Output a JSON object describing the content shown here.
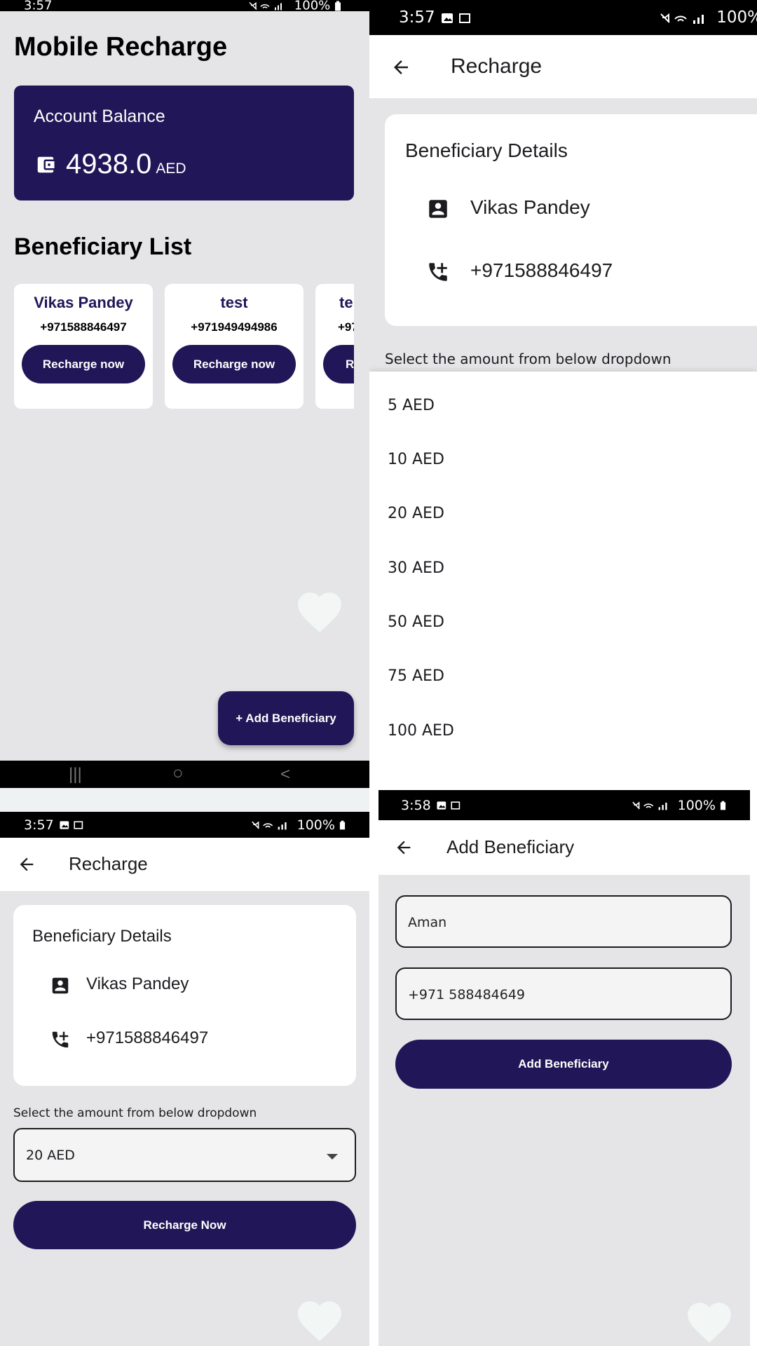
{
  "colors": {
    "primary": "#211657",
    "background": "#e5e5e7",
    "surface": "#ffffff"
  },
  "panel_home": {
    "status": {
      "time": "3:57",
      "battery": "100%"
    },
    "title": "Mobile Recharge",
    "balance": {
      "label": "Account Balance",
      "amount": "4938.0",
      "currency": "AED",
      "icon": "wallet-icon"
    },
    "section_title": "Beneficiary List",
    "beneficiaries": [
      {
        "name": "Vikas Pandey",
        "phone": "+971588846497",
        "button": "Recharge now"
      },
      {
        "name": "test",
        "phone": "+971949494986",
        "button": "Recharge now"
      },
      {
        "name": "te",
        "phone": "+97",
        "button": "R"
      }
    ],
    "fab_label": "+ Add Beneficiary",
    "navbar": {
      "recents": "|||",
      "home": "○",
      "back": "<"
    }
  },
  "panel_recharge_open": {
    "status": {
      "time": "3:57",
      "battery": "100%"
    },
    "title": "Recharge",
    "card_title": "Beneficiary Details",
    "name": "Vikas Pandey",
    "phone": "+971588846497",
    "prompt": "Select the amount from below dropdown",
    "options": [
      "5 AED",
      "10 AED",
      "20 AED",
      "30 AED",
      "50 AED",
      "75 AED",
      "100 AED"
    ]
  },
  "panel_recharge": {
    "status": {
      "time": "3:57",
      "battery": "100%"
    },
    "title": "Recharge",
    "card_title": "Beneficiary Details",
    "name": "Vikas Pandey",
    "phone": "+971588846497",
    "prompt": "Select the amount from below dropdown",
    "selected_amount": "20 AED",
    "button": "Recharge Now"
  },
  "panel_add": {
    "status": {
      "time": "3:58",
      "battery": "100%"
    },
    "title": "Add Beneficiary",
    "name_value": "Aman",
    "phone_value": "+971 588484649",
    "button": "Add Beneficiary"
  }
}
